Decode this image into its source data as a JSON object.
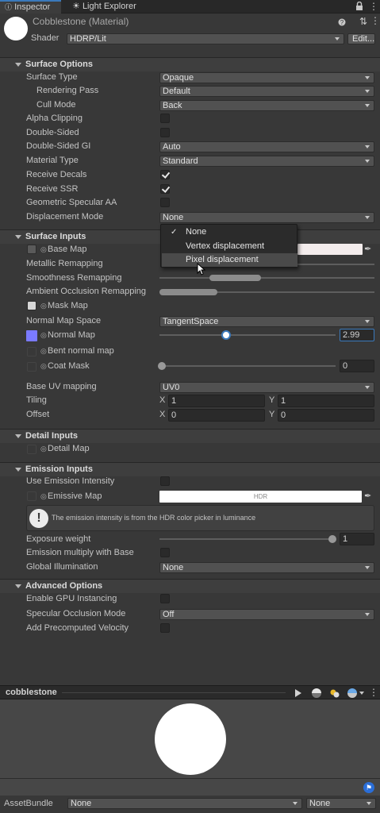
{
  "tabs": {
    "inspector": "Inspector",
    "light_explorer": "Light Explorer"
  },
  "header": {
    "title": "Cobblestone (Material)",
    "shader_label": "Shader",
    "shader_value": "HDRP/Lit",
    "edit_label": "Edit..."
  },
  "surface_options": {
    "title": "Surface Options",
    "surface_type": {
      "label": "Surface Type",
      "value": "Opaque"
    },
    "rendering_pass": {
      "label": "Rendering Pass",
      "value": "Default"
    },
    "cull_mode": {
      "label": "Cull Mode",
      "value": "Back"
    },
    "alpha_clipping": {
      "label": "Alpha Clipping"
    },
    "double_sided": {
      "label": "Double-Sided"
    },
    "double_sided_gi": {
      "label": "Double-Sided GI",
      "value": "Auto"
    },
    "material_type": {
      "label": "Material Type",
      "value": "Standard"
    },
    "receive_decals": {
      "label": "Receive Decals"
    },
    "receive_ssr": {
      "label": "Receive SSR"
    },
    "geometric_aa": {
      "label": "Geometric Specular AA"
    },
    "displacement_mode": {
      "label": "Displacement Mode",
      "value": "None"
    }
  },
  "surface_inputs": {
    "title": "Surface Inputs",
    "base_map": "Base Map",
    "metallic_remapping": "Metallic Remapping",
    "smoothness_remapping": "Smoothness Remapping",
    "ao_remapping": "Ambient Occlusion Remapping",
    "mask_map": "Mask Map",
    "normal_map_space": {
      "label": "Normal Map Space",
      "value": "TangentSpace"
    },
    "normal_map": {
      "label": "Normal Map",
      "value": "2.99"
    },
    "bent_normal_map": "Bent normal map",
    "coat_mask": {
      "label": "Coat Mask",
      "value": "0"
    },
    "base_uv_mapping": {
      "label": "Base UV mapping",
      "value": "UV0"
    },
    "tiling": {
      "label": "Tiling",
      "x_label": "X",
      "x": "1",
      "y_label": "Y",
      "y": "1"
    },
    "offset": {
      "label": "Offset",
      "x_label": "X",
      "x": "0",
      "y_label": "Y",
      "y": "0"
    }
  },
  "detail_inputs": {
    "title": "Detail Inputs",
    "detail_map": "Detail Map"
  },
  "emission_inputs": {
    "title": "Emission Inputs",
    "use_intensity": "Use Emission Intensity",
    "emissive_map": "Emissive Map",
    "hdr_label": "HDR",
    "info": "The emission intensity is from the HDR color picker in luminance",
    "exposure_weight": {
      "label": "Exposure weight",
      "value": "1"
    },
    "multiply_base": "Emission multiply with Base",
    "global_illumination": {
      "label": "Global Illumination",
      "value": "None"
    }
  },
  "advanced_options": {
    "title": "Advanced Options",
    "gpu_instancing": "Enable GPU Instancing",
    "specular_occlusion": {
      "label": "Specular Occlusion Mode",
      "value": "Off"
    },
    "precomputed_velocity": "Add Precomputed Velocity"
  },
  "dropdown_menu": {
    "items": [
      "None",
      "Vertex displacement",
      "Pixel displacement"
    ],
    "checked": "None",
    "hovered": "Pixel displacement"
  },
  "preview": {
    "title": "cobblestone"
  },
  "footer": {
    "label": "AssetBundle",
    "bundle": "None",
    "variant": "None"
  },
  "colors": {
    "accent": "#3a79bb",
    "normal_swatch": "#7a7aff",
    "panel": "#383838"
  }
}
